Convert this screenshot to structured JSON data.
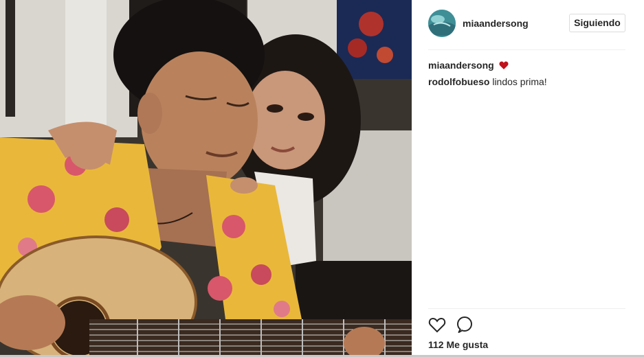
{
  "post": {
    "image_alt": "Foto antigua: hombre tocando la guitarra con una niña apoyada en su hombro",
    "palette": {
      "shirt_yellow": "#e9b83a",
      "flower_pink": "#d8576a",
      "guitar_wood": "#d7b27a",
      "background_dark": "#2a2622"
    }
  },
  "header": {
    "username": "miaandersong",
    "follow_label": "Siguiendo",
    "avatar_icon": "avatar-ocean-icon"
  },
  "comments": [
    {
      "author": "miaandersong",
      "text": "",
      "emoji": "red-heart-icon"
    },
    {
      "author": "rodolfobueso",
      "text": "lindos prima!"
    }
  ],
  "actions": {
    "like_icon": "heart-outline-icon",
    "comment_icon": "speech-bubble-icon",
    "likes_text": "112 Me gusta"
  },
  "colors": {
    "text": "#262626",
    "divider": "#efefef",
    "button_border": "#dbdbdb",
    "heart_red": "#c0121c"
  }
}
